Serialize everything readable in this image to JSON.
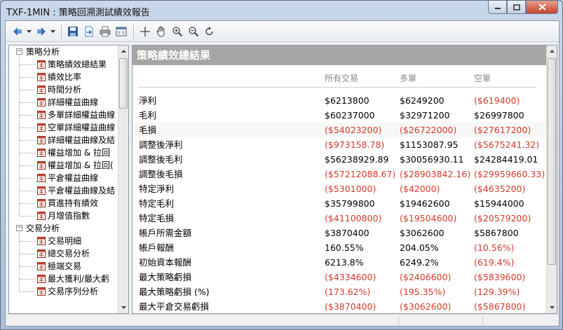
{
  "window": {
    "title": "TXF-1MIN : 策略回溯測試績效報告"
  },
  "toolbar": {
    "icons": [
      "back-icon",
      "forward-icon",
      "save-icon",
      "export-icon",
      "print-icon",
      "view-icon",
      "crosshair-icon",
      "hand-icon",
      "zoom-in-icon",
      "zoom-out-icon",
      "refresh-icon"
    ]
  },
  "tree": {
    "groups": [
      {
        "label": "策略分析",
        "items": [
          "策略績效總結果",
          "績效比率",
          "時間分析",
          "詳細權益曲線",
          "多單詳細權益曲線",
          "空單詳細權益曲線",
          "詳細權益曲線及結",
          "權益增加 & 拉回",
          "權益增加 & 拉回(",
          "平倉權益曲線",
          "平倉權益曲線及結",
          "買進持有績效",
          "月增值指數"
        ]
      },
      {
        "label": "交易分析",
        "items": [
          "交易明細",
          "總交易分析",
          "極端交易",
          "最大獲利/最大虧",
          "交易序列分析"
        ]
      }
    ]
  },
  "report": {
    "header": "策略績效總結果",
    "columns": [
      "所有交易",
      "多單",
      "空單"
    ],
    "rows": [
      {
        "label": "淨利",
        "all": "$6213800",
        "long": "$6249200",
        "short": "($619400)",
        "neg": [
          false,
          false,
          true
        ]
      },
      {
        "label": "毛利",
        "all": "$60237000",
        "long": "$32971200",
        "short": "$26997800",
        "neg": [
          false,
          false,
          false
        ]
      },
      {
        "label": "毛損",
        "all": "($54023200)",
        "long": "($26722000)",
        "short": "($27617200)",
        "neg": [
          true,
          true,
          true
        ]
      },
      {
        "label": "調整後淨利",
        "all": "($973158.78)",
        "long": "$1153087.95",
        "short": "($5675241.32)",
        "neg": [
          true,
          false,
          true
        ]
      },
      {
        "label": "調整後毛利",
        "all": "$56238929.89",
        "long": "$30056930.11",
        "short": "$24284419.01",
        "neg": [
          false,
          false,
          false
        ]
      },
      {
        "label": "調整後毛損",
        "all": "($57212088.67)",
        "long": "($28903842.16)",
        "short": "($29959660.33)",
        "neg": [
          true,
          true,
          true
        ]
      },
      {
        "label": "特定淨利",
        "all": "($5301000)",
        "long": "($42000)",
        "short": "($4635200)",
        "neg": [
          true,
          true,
          true
        ]
      },
      {
        "label": "特定毛利",
        "all": "$35799800",
        "long": "$19462600",
        "short": "$15944000",
        "neg": [
          false,
          false,
          false
        ]
      },
      {
        "label": "特定毛損",
        "all": "($41100800)",
        "long": "($19504600)",
        "short": "($20579200)",
        "neg": [
          true,
          true,
          true
        ]
      },
      {
        "label": "帳戶所需金額",
        "all": "$3870400",
        "long": "$3062600",
        "short": "$5867800",
        "neg": [
          false,
          false,
          false
        ]
      },
      {
        "label": "帳戶報酬",
        "all": "160.55%",
        "long": "204.05%",
        "short": "(10.56%)",
        "neg": [
          false,
          false,
          true
        ]
      },
      {
        "label": "初始資本報酬",
        "all": "6213.8%",
        "long": "6249.2%",
        "short": "(619.4%)",
        "neg": [
          false,
          false,
          true
        ]
      },
      {
        "label": "最大策略虧損",
        "all": "($4334600)",
        "long": "($2406600)",
        "short": "($5839600)",
        "neg": [
          true,
          true,
          true
        ]
      },
      {
        "label": "最大策略虧損 (%)",
        "all": "(173.62%)",
        "long": "(195.35%)",
        "short": "(129.39%)",
        "neg": [
          true,
          true,
          true
        ]
      },
      {
        "label": "最大平倉交易虧損",
        "all": "($3870400)",
        "long": "($3062600)",
        "short": "($5867800)",
        "neg": [
          true,
          true,
          true
        ]
      }
    ]
  },
  "colors": {
    "negative": "#d23a2a",
    "header_bg": "#a5a5a5"
  }
}
